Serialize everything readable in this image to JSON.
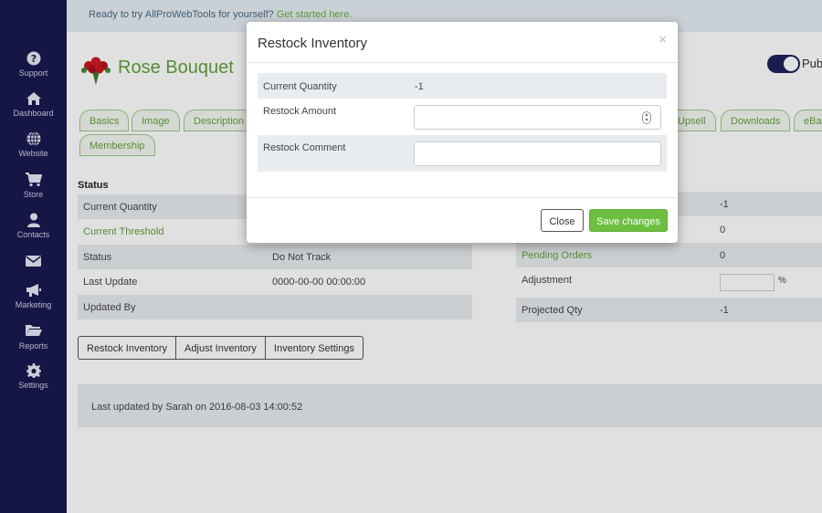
{
  "sidebar": {
    "items": [
      {
        "label": "Support",
        "icon": "question-circle-icon"
      },
      {
        "label": "Dashboard",
        "icon": "home-icon"
      },
      {
        "label": "Website",
        "icon": "globe-icon"
      },
      {
        "label": "Store",
        "icon": "cart-icon"
      },
      {
        "label": "Contacts",
        "icon": "user-icon"
      },
      {
        "label": "",
        "icon": "envelope-icon"
      },
      {
        "label": "Marketing",
        "icon": "megaphone-icon"
      },
      {
        "label": "Reports",
        "icon": "folder-icon"
      },
      {
        "label": "Settings",
        "icon": "gear-icon"
      }
    ]
  },
  "banner": {
    "text": "Ready to try AllProWebTools for yourself?",
    "link": "Get started here."
  },
  "product": {
    "title": "Rose Bouquet",
    "publish_label": "Pub"
  },
  "tabs": [
    {
      "label": "Basics"
    },
    {
      "label": "Image"
    },
    {
      "label": "Description"
    },
    {
      "label": "Upsell"
    },
    {
      "label": "Downloads"
    },
    {
      "label": "eBay"
    },
    {
      "label": "Membership"
    }
  ],
  "status": {
    "heading": "Status",
    "left_rows": [
      {
        "label": "Current Quantity",
        "value": ""
      },
      {
        "label": "Current Threshold",
        "value": ""
      },
      {
        "label": "Status",
        "value": "Do Not Track"
      },
      {
        "label": "Last Update",
        "value": "0000-00-00 00:00:00"
      },
      {
        "label": "Updated By",
        "value": ""
      }
    ],
    "right_rows": [
      {
        "label": "",
        "value": "-1"
      },
      {
        "label": "",
        "value": "0"
      },
      {
        "label": "Pending Orders",
        "value": "0"
      },
      {
        "label": "Adjustment",
        "value": "%"
      },
      {
        "label": "Projected Qty",
        "value": "-1"
      }
    ]
  },
  "actions": {
    "restock": "Restock Inventory",
    "adjust": "Adjust Inventory",
    "settings": "Inventory Settings"
  },
  "footer": {
    "text": "Last updated by Sarah on 2016-08-03 14:00:52"
  },
  "modal": {
    "title": "Restock Inventory",
    "close_glyph": "×",
    "rows": [
      {
        "label": "Current Quantity",
        "value": "-1"
      },
      {
        "label": "Restock Amount",
        "value": ""
      },
      {
        "label": "Restock Comment",
        "value": ""
      }
    ],
    "close_button": "Close",
    "save_button": "Save changes"
  },
  "colors": {
    "sidebar": "#181a4f",
    "accent_green": "#6cbf3f",
    "link_green": "#5fa23a"
  }
}
